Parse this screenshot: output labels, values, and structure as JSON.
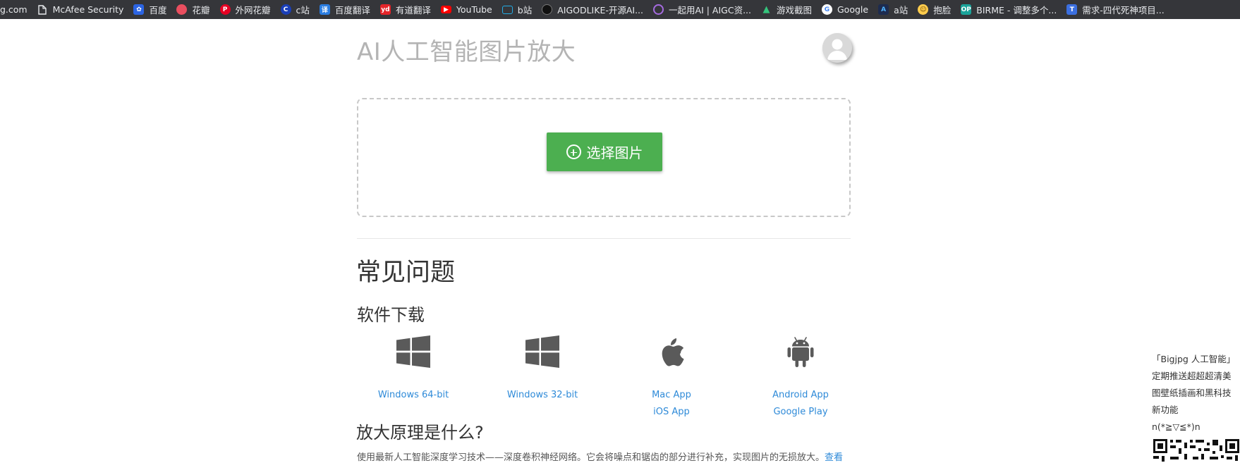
{
  "bookmarks": [
    {
      "label": "g.com",
      "icon": "none",
      "color": ""
    },
    {
      "label": "McAfee Security",
      "icon": "page-icon",
      "color": "#e8eaed"
    },
    {
      "label": "百度",
      "icon": "baidu-icon",
      "color": "#2b64e3"
    },
    {
      "label": "花瓣",
      "icon": "huaban-icon",
      "color": "#e94e5f"
    },
    {
      "label": "外网花瓣",
      "icon": "pinterest-icon",
      "color": "#e60023"
    },
    {
      "label": "c站",
      "icon": "c-icon",
      "color": "#1a3fb8"
    },
    {
      "label": "百度翻译",
      "icon": "translate-icon",
      "color": "#2a7de1"
    },
    {
      "label": "有道翻译",
      "icon": "youdao-icon",
      "color": "#e5252a"
    },
    {
      "label": "YouTube",
      "icon": "youtube-icon",
      "color": "#ff0000"
    },
    {
      "label": "b站",
      "icon": "bilibili-icon",
      "color": "#23ade5"
    },
    {
      "label": "AIGODLIKE-开源AI...",
      "icon": "aigodlike-icon",
      "color": "#111111"
    },
    {
      "label": "一起用AI | AIGC资...",
      "icon": "aigc-icon",
      "color": "#8e44ad"
    },
    {
      "label": "游戏截图",
      "icon": "game-icon",
      "color": "#34c47c"
    },
    {
      "label": "Google",
      "icon": "google-icon",
      "color": "#4285f4"
    },
    {
      "label": "a站",
      "icon": "a-icon",
      "color": "#1d2b4f"
    },
    {
      "label": "抱脸",
      "icon": "huggingface-icon",
      "color": "#ffcc4d"
    },
    {
      "label": "BIRME - 调整多个...",
      "icon": "op-icon",
      "color": "#1aa39a"
    },
    {
      "label": "需求-四代死神项目...",
      "icon": "tapd-icon",
      "color": "#3b6fe0"
    }
  ],
  "header": {
    "title": "AI人工智能图片放大"
  },
  "upload": {
    "button_label": "选择图片"
  },
  "faq": {
    "title": "常见问题",
    "downloads_title": "软件下载",
    "downloads": [
      {
        "icon": "windows-icon",
        "links": [
          "Windows 64-bit"
        ]
      },
      {
        "icon": "windows-icon",
        "links": [
          "Windows 32-bit"
        ]
      },
      {
        "icon": "apple-icon",
        "links": [
          "Mac App",
          "iOS App"
        ]
      },
      {
        "icon": "android-icon",
        "links": [
          "Android App",
          "Google Play"
        ]
      }
    ],
    "principle_title": "放大原理是什么?",
    "principle_text": "使用最新人工智能深度学习技术——深度卷积神经网络。它会将噪点和锯齿的部分进行补充，实现图片的无损放大。",
    "principle_more": "查看"
  },
  "promo": {
    "lines": [
      "「Bigjpg 人工智能」",
      "定期推送超超超清美",
      "图壁纸插画和黑科技",
      "新功能",
      "n(*≧▽≦*)n"
    ]
  },
  "colors": {
    "accent_green": "#4caf50",
    "link_blue": "#2e8ad8",
    "bookmark_bar": "#35363a"
  }
}
